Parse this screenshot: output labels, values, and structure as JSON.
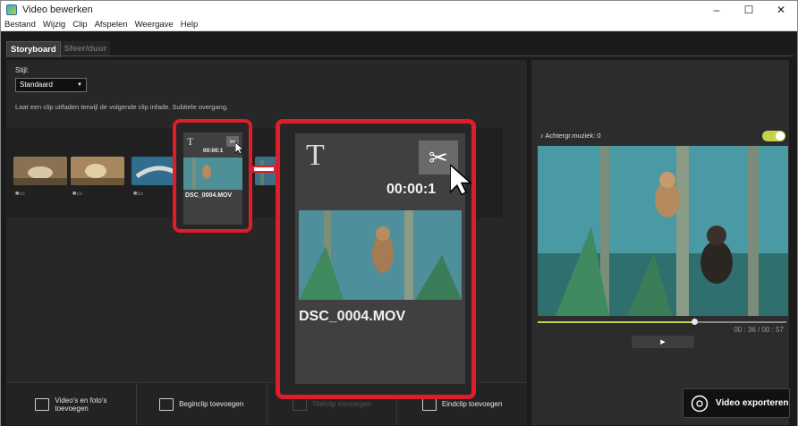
{
  "window": {
    "title": "Video bewerken"
  },
  "menu": [
    "Bestand",
    "Wijzig",
    "Clip",
    "Afspelen",
    "Weergave",
    "Help"
  ],
  "tabs": [
    {
      "label": "Storyboard",
      "active": true
    },
    {
      "label": "Sfeer/duur",
      "active": false
    }
  ],
  "style": {
    "label": "Stijl:",
    "value": "Standaard",
    "description": "Laat een clip uitfaden terwijl de volgende clip infade. Subtiele overgang."
  },
  "clip": {
    "title_glyph": "T",
    "time": "00:00:1",
    "time_small": "00:00:1",
    "name": "DSC_0004.MOV"
  },
  "bottom_buttons": [
    {
      "label": "Video's en foto's\ntoevoegen",
      "enabled": true
    },
    {
      "label": "Beginclip toevoegen",
      "enabled": true
    },
    {
      "label": "Titelclip toevoegen",
      "enabled": false
    },
    {
      "label": "Eindclip toevoegen",
      "enabled": true
    }
  ],
  "music": {
    "label": "Achtergr.muziek: 0",
    "enabled": true
  },
  "playback": {
    "current": "00 : 36",
    "separator": "/",
    "total": "00 : 57",
    "progress": 0.63
  },
  "export": {
    "label": "Video exporteren"
  },
  "colors": {
    "accent": "#c6d24a",
    "callout": "#e01c2a"
  }
}
